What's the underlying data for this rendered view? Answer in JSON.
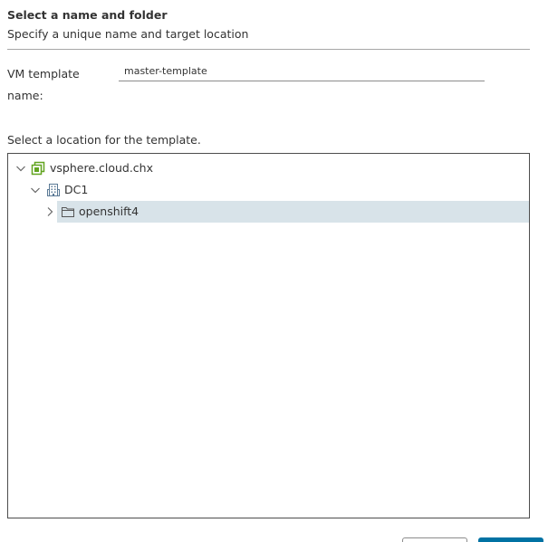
{
  "header": {
    "title": "Select a name and folder",
    "subtitle": "Specify a unique name and target location"
  },
  "form": {
    "vm_template_label": "VM template name:",
    "vm_template_value": "master-template"
  },
  "location": {
    "label": "Select a location for the template."
  },
  "tree": {
    "vcenter": {
      "label": "vsphere.cloud.chx",
      "expanded": true,
      "icon": "vcenter-icon"
    },
    "datacenter": {
      "label": "DC1",
      "expanded": true,
      "icon": "datacenter-icon"
    },
    "folder": {
      "label": "openshift4",
      "expanded": false,
      "selected": true,
      "icon": "folder-icon"
    }
  },
  "colors": {
    "selected_row": "#d8e3e9",
    "vcenter_green": "#62a420",
    "primary_button": "#0072a3"
  }
}
